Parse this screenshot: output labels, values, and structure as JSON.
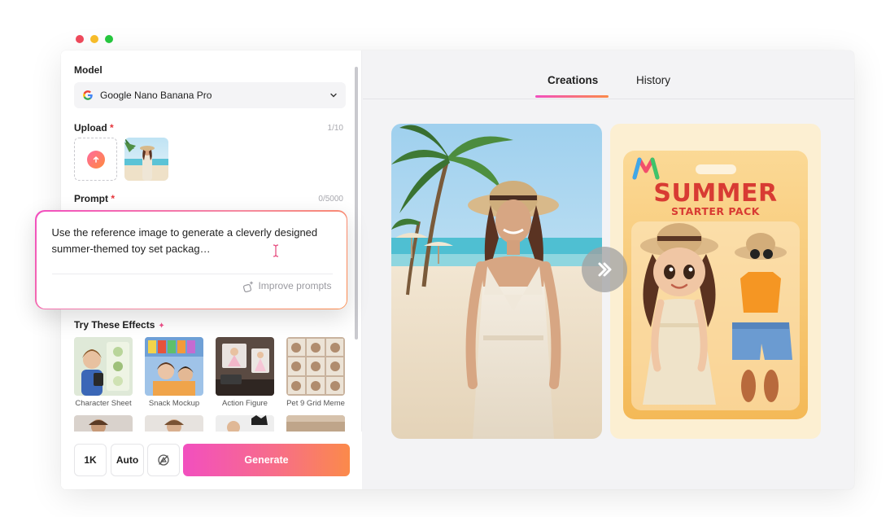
{
  "window": {
    "dots": {
      "red": "#f04a5c",
      "yellow": "#f9be2a",
      "green": "#27c93f"
    }
  },
  "panel": {
    "model": {
      "label": "Model",
      "selected": "Google Nano Banana Pro",
      "icon": "google-g-icon"
    },
    "upload": {
      "label": "Upload",
      "required_mark": "*",
      "count": "1/10",
      "icon": "upload-arrow-icon"
    },
    "prompt": {
      "label": "Prompt",
      "required_mark": "*",
      "count": "0/5000",
      "text": "Use the reference image to generate a cleverly designed summer-themed toy set packag…",
      "improve_label": "Improve prompts",
      "improve_icon": "magic-wand-icon"
    },
    "effects": {
      "title": "Try These Effects",
      "sparkle_icon": "sparkle-icon",
      "items": [
        {
          "label": "Character Sheet"
        },
        {
          "label": "Snack Mockup"
        },
        {
          "label": "Action Figure"
        },
        {
          "label": "Pet 9 Grid Meme"
        }
      ]
    },
    "bottom": {
      "resolution": "1K",
      "ratio": "Auto",
      "pin_icon": "no-watermark-icon",
      "generate": "Generate"
    }
  },
  "right": {
    "tabs": [
      {
        "label": "Creations",
        "active": true
      },
      {
        "label": "History",
        "active": false
      }
    ],
    "toy_card": {
      "title": "SUMMER",
      "subtitle": "STARTER PACK"
    },
    "arrow_icon": "chevron-right-double-icon"
  },
  "colors": {
    "accent_pink": "#f24fbf",
    "accent_orange": "#fb8a4a",
    "required": "#e5343a"
  }
}
